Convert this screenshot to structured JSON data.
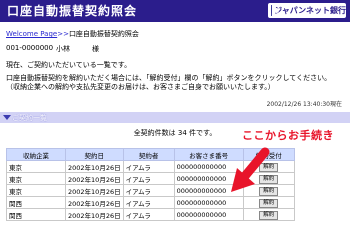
{
  "header": {
    "title": "口座自動振替契約照会",
    "logo_text": "ジャパンネット銀行"
  },
  "breadcrumb": {
    "home": "Welcome Page",
    "separator": ">>",
    "current": "口座自動振替契約照会"
  },
  "user": {
    "id": "001-0000000",
    "name": "小林",
    "honorific": "様"
  },
  "notice": "現在、ご契約いただいている一覧です。",
  "description": "口座自動振替契約を解約いただく場合には、「解約受付」欄の「解約」ボタンをクリックしてください。（収納企業への解約や支払先変更のお届けは、お客さまご自身でお願いいたします。）",
  "timestamp": "2002/12/26 13:40:30現在",
  "section_title": "ご契約一覧",
  "count_text": "全契約件数は 34 件です。",
  "table": {
    "headers": [
      "収納企業",
      "契約日",
      "契約者",
      "お客さま番号",
      "解約受付"
    ],
    "rows": [
      {
        "company": "東京",
        "date": "2002年10月26日",
        "holder": "イアムラ",
        "number": "000000000000",
        "action": "解約"
      },
      {
        "company": "東京",
        "date": "2002年10月26日",
        "holder": "イアムラ",
        "number": "000000000000",
        "action": "解約"
      },
      {
        "company": "東京",
        "date": "2002年10月26日",
        "holder": "イアムラ",
        "number": "000000000000",
        "action": "解約"
      },
      {
        "company": "関西",
        "date": "2002年10月26日",
        "holder": "イアムラ",
        "number": "000000000000",
        "action": "解約"
      },
      {
        "company": "関西",
        "date": "2002年10月26日",
        "holder": "イアムラ",
        "number": "000000000000",
        "action": "解約"
      }
    ]
  },
  "callout": "ここからお手続き",
  "colors": {
    "header": "#2b1d8c",
    "section": "#d2d2f5",
    "table_header": "#cfdcff",
    "callout": "#e8142a"
  }
}
